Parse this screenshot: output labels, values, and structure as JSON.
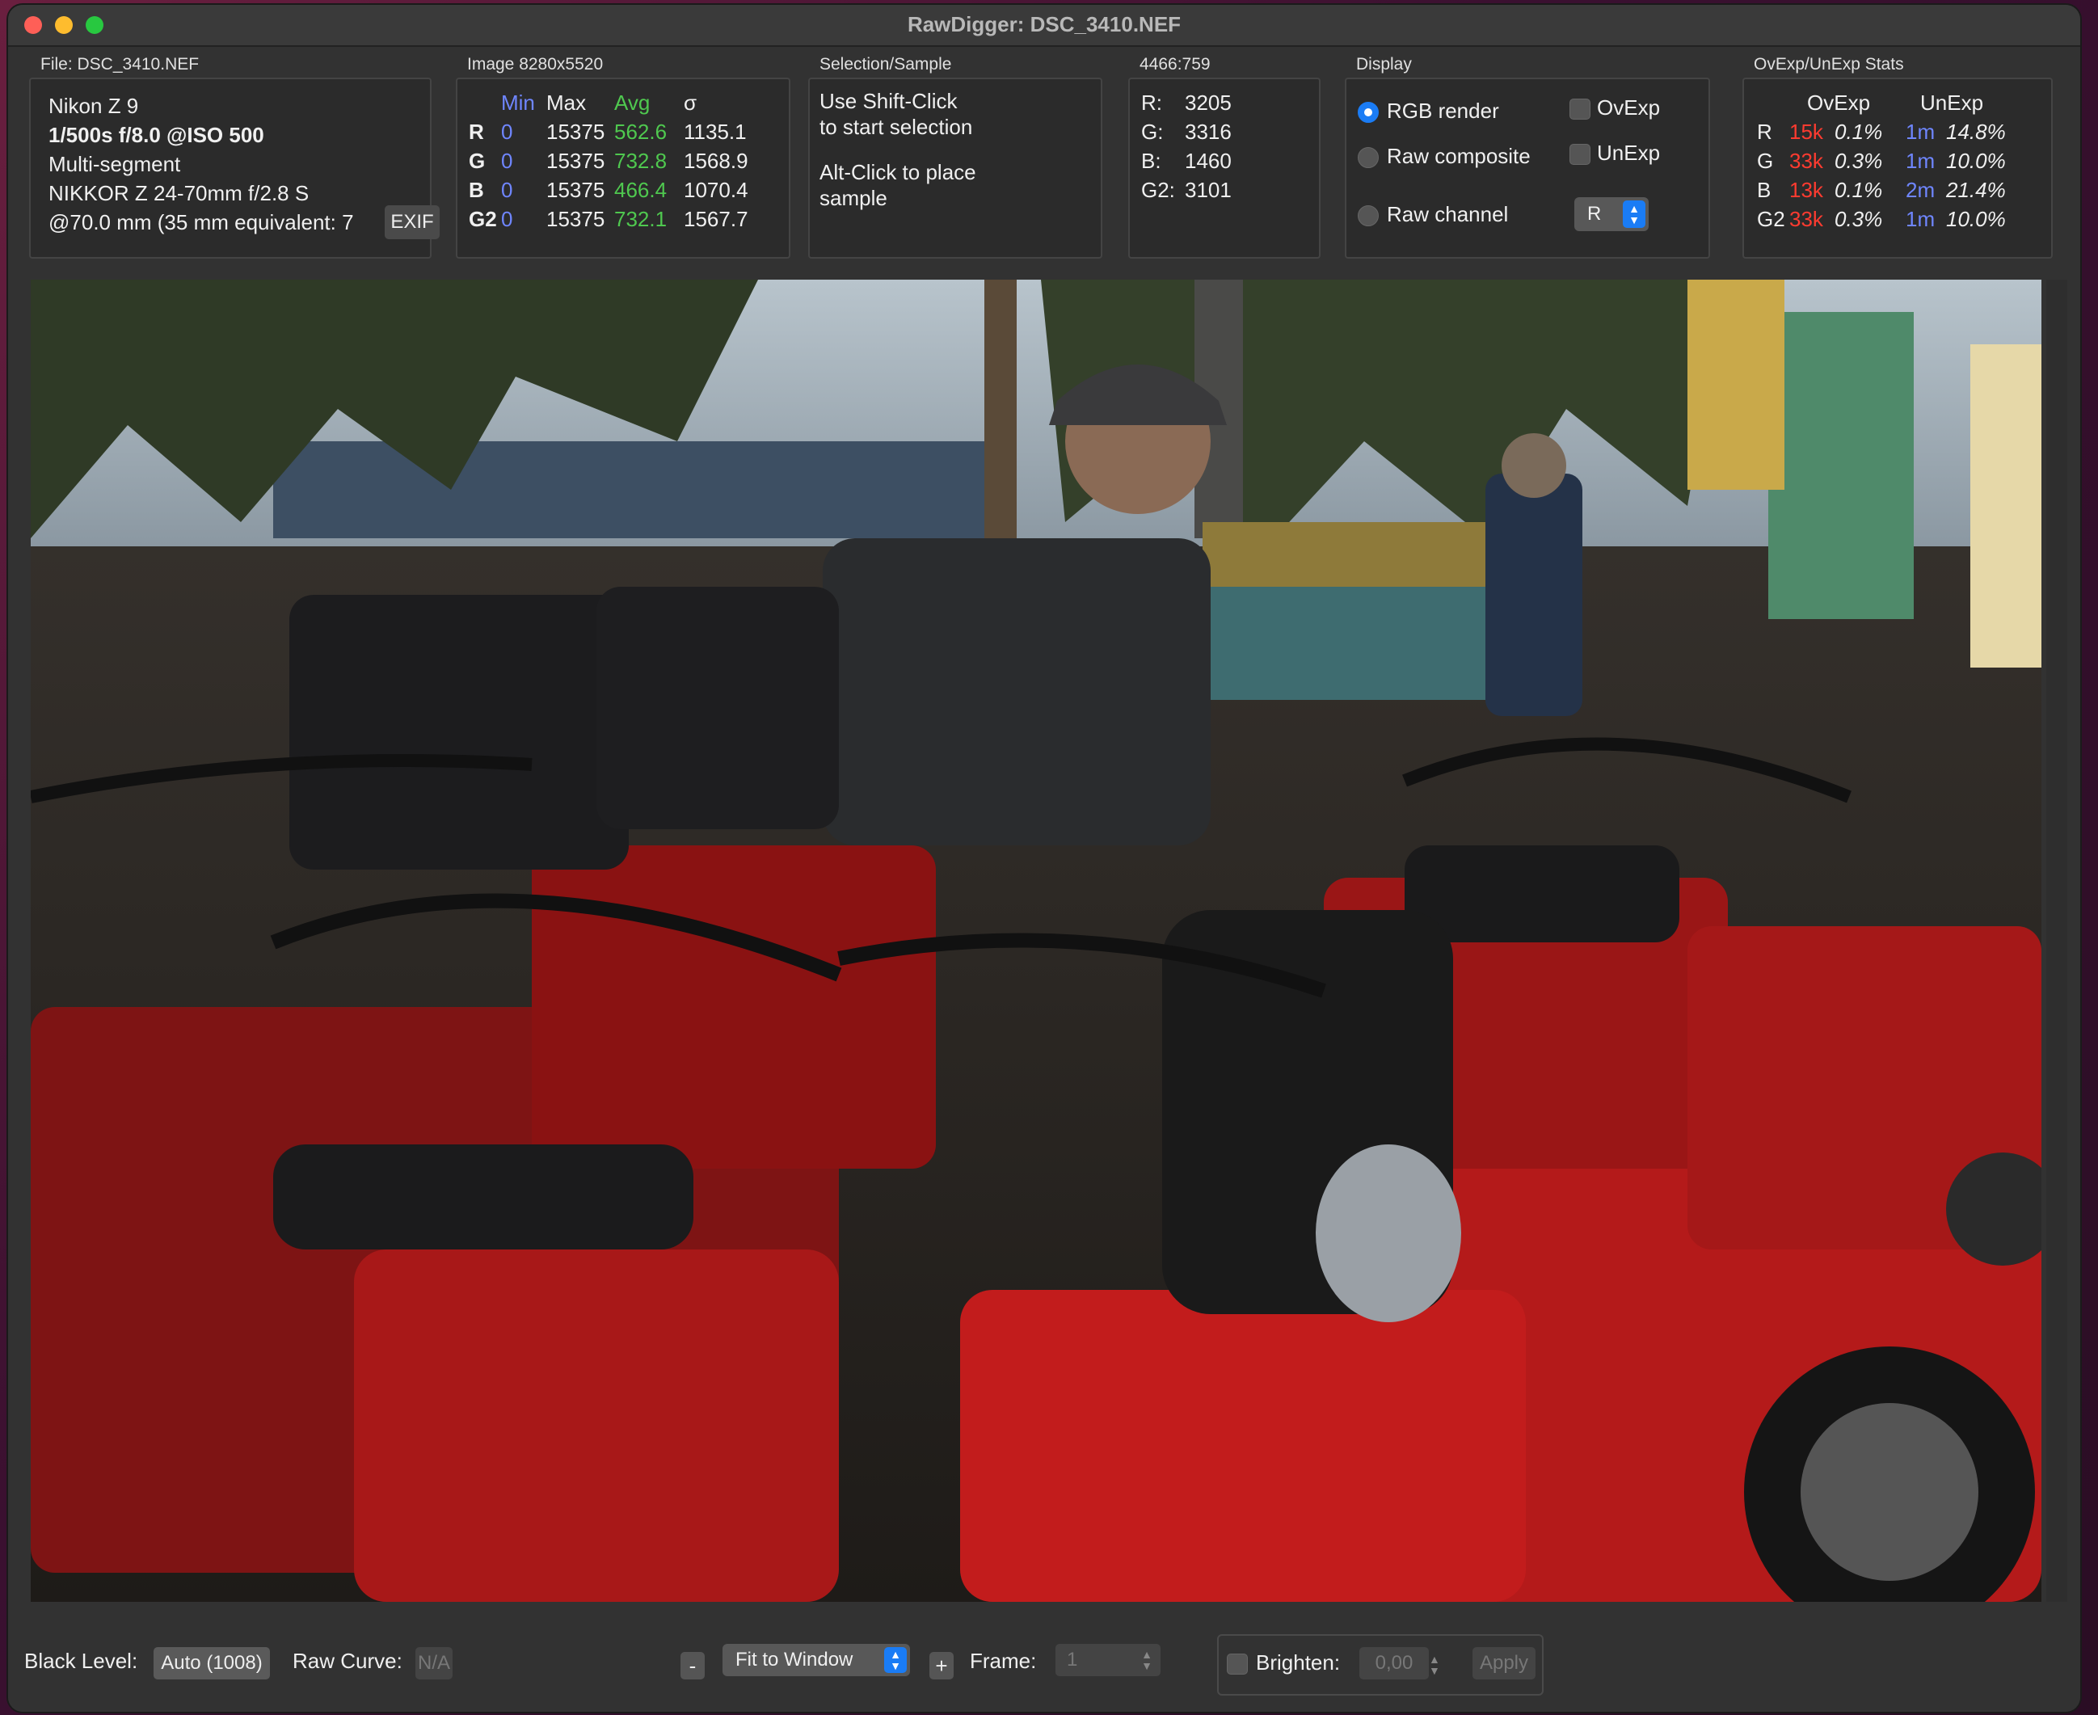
{
  "window": {
    "title": "RawDigger: DSC_3410.NEF"
  },
  "file": {
    "label": "File: DSC_3410.NEF",
    "camera": "Nikon Z 9",
    "exposure": "1/500s f/8.0 @ISO 500",
    "metering": "Multi-segment",
    "lens": "NIKKOR Z 24-70mm f/2.8 S",
    "focal": "@70.0 mm (35 mm equivalent: 7",
    "exif_button": "EXIF"
  },
  "image": {
    "label": "Image 8280x5520",
    "headers": {
      "min": "Min",
      "max": "Max",
      "avg": "Avg",
      "sigma": "σ"
    },
    "rows": [
      {
        "ch": "R",
        "min": "0",
        "max": "15375",
        "avg": "562.6",
        "sigma": "1135.1"
      },
      {
        "ch": "G",
        "min": "0",
        "max": "15375",
        "avg": "732.8",
        "sigma": "1568.9"
      },
      {
        "ch": "B",
        "min": "0",
        "max": "15375",
        "avg": "466.4",
        "sigma": "1070.4"
      },
      {
        "ch": "G2",
        "min": "0",
        "max": "15375",
        "avg": "732.1",
        "sigma": "1567.7"
      }
    ]
  },
  "selection": {
    "label": "Selection/Sample",
    "line1": "Use Shift-Click",
    "line2": "to start selection",
    "line3": "Alt-Click to place",
    "line4": "sample"
  },
  "sample": {
    "label": "4466:759",
    "rows": [
      {
        "ch": "R:",
        "val": "3205"
      },
      {
        "ch": "G:",
        "val": "3316"
      },
      {
        "ch": "B:",
        "val": "1460"
      },
      {
        "ch": "G2:",
        "val": "3101"
      }
    ]
  },
  "display": {
    "label": "Display",
    "rgb_render": "RGB render",
    "raw_composite": "Raw composite",
    "raw_channel": "Raw channel",
    "ovexp": "OvExp",
    "unexp": "UnExp",
    "channel_value": "R"
  },
  "stats": {
    "label": "OvExp/UnExp Stats",
    "h_ovexp": "OvExp",
    "h_unexp": "UnExp",
    "rows": [
      {
        "ch": "R",
        "ov_n": "15k",
        "ov_p": "0.1%",
        "un_n": "1m",
        "un_p": "14.8%"
      },
      {
        "ch": "G",
        "ov_n": "33k",
        "ov_p": "0.3%",
        "un_n": "1m",
        "un_p": "10.0%"
      },
      {
        "ch": "B",
        "ov_n": "13k",
        "ov_p": "0.1%",
        "un_n": "2m",
        "un_p": "21.4%"
      },
      {
        "ch": "G2",
        "ov_n": "33k",
        "ov_p": "0.3%",
        "un_n": "1m",
        "un_p": "10.0%"
      }
    ]
  },
  "bottom": {
    "black_level_label": "Black Level:",
    "black_level_value": "Auto (1008)",
    "raw_curve_label": "Raw Curve:",
    "raw_curve_value": "N/A",
    "zoom_minus": "-",
    "zoom_value": "Fit to Window",
    "zoom_plus": "+",
    "frame_label": "Frame:",
    "frame_value": "1",
    "brighten_label": "Brighten:",
    "brighten_value": "0,00",
    "apply": "Apply"
  },
  "colors": {
    "accent": "#1a7cf5",
    "min": "#6f86ff",
    "avg": "#4fc84f",
    "over": "#ff3b30"
  }
}
